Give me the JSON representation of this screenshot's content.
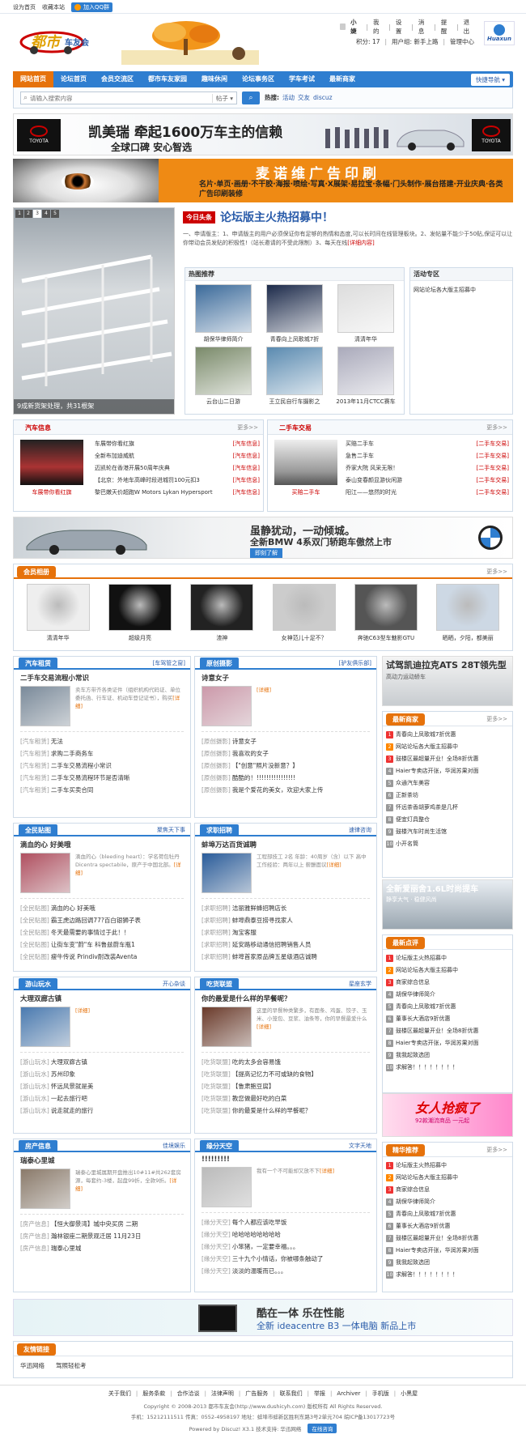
{
  "topbar": {
    "home": "设为首页",
    "fav": "收藏本站",
    "qq": "加入QQ群"
  },
  "user": {
    "name": "小婕",
    "my": "我的",
    "settings": "设置",
    "messages": "消息",
    "reminders": "提醒",
    "logout": "退出",
    "points": "积分: 17",
    "group": "用户组: 新手上路",
    "admin": "管理中心"
  },
  "logo": {
    "right_text": "Huaxun"
  },
  "nav": {
    "items": [
      "网站首页",
      "论坛首页",
      "会员交流区",
      "都市车友家园",
      "趣味休闲",
      "论坛事务区",
      "学车考试",
      "最新商家"
    ],
    "quick": "快捷导航"
  },
  "search": {
    "placeholder": "请输入搜索内容",
    "type": "帖子",
    "hot_label": "热搜:",
    "hot": [
      "活动",
      "交友",
      "discuz"
    ]
  },
  "banner1": {
    "title": "凯美瑞 牵起1600万车主的信赖",
    "sub": "全球口碑 安心智选"
  },
  "banner2": {
    "title": "麦诺维广告印刷",
    "sub": "名片·单页·画册·不干胶·海报·喷绘·写真·X展架·易拉宝·条幅·门头制作·展台搭建·开业庆典·各类广告印刷装修"
  },
  "slide": {
    "pages": [
      "1",
      "2",
      "3",
      "4",
      "5"
    ],
    "caption": "9成新货架处理，共31根架"
  },
  "headline": {
    "tag": "今日头条",
    "title": "论坛版主火热招募中！",
    "body": "一、申请版主：1、申请版主的用户必须保证你有足够的热情和态度,可以长时间在线管理板块。2、发帖量不能少于50贴,保证可以让你带动会员发贴的积极性!（站长邀请的不受此限制）3、每天在线",
    "more": "[详细内容]"
  },
  "hot": {
    "title": "热图推荐",
    "items": [
      "胡保华律师简介",
      "青春向上凤歌城7折",
      "清清年华",
      "云台山二日游",
      "王立民自行车摄影之",
      "2013年11月CTCC赛车"
    ]
  },
  "activity": {
    "title": "活动专区",
    "items": [
      "网站论坛各大版主招募中"
    ]
  },
  "carinfo": {
    "title": "汽车信息",
    "more": "更多>>",
    "caption": "车展带你看红旗",
    "items": [
      {
        "t": "车展带你看红旗",
        "c": "[汽车信息]"
      },
      {
        "t": "全新布加迪威航",
        "c": "[汽车信息]"
      },
      {
        "t": "迈凯轮在香港开展50周年庆典",
        "c": "[汽车信息]"
      },
      {
        "t": "【北京：外地车高峰时段进城罚100元扣3",
        "c": "[汽车信息]"
      },
      {
        "t": "黎巴嫩天价超跑W Motors Lykan Hypersport",
        "c": "[汽车信息]"
      }
    ]
  },
  "usedcar": {
    "title": "二手车交易",
    "more": "更多>>",
    "caption": "买赔二手车",
    "items": [
      {
        "t": "买赔二手车",
        "c": "[二手车交易]"
      },
      {
        "t": "急售二手车",
        "c": "[二手车交易]"
      },
      {
        "t": "乔家大院 风采无限！",
        "c": "[二手车交易]"
      },
      {
        "t": "泰山变春颜显游伙闲游",
        "c": "[二手车交易]"
      },
      {
        "t": "阳江——悠然的时光",
        "c": "[二手车交易]"
      }
    ]
  },
  "bmw": {
    "title": "虽静犹动，一动倾城。",
    "sub": "全新BMW 4系双门轿跑车傲然上市",
    "btn": "即刻了解"
  },
  "album": {
    "title": "会员相册",
    "more": "更多>>",
    "items": [
      "清清年华",
      "超级月亮",
      "渣神",
      "女神范儿十足不？",
      "奔驰C63型车魅影GTU",
      "晒晒，夕阳，都美丽"
    ]
  },
  "panels": {
    "p1": {
      "title": "汽车租赁",
      "tag": "[车驾管之窗]",
      "head": "二手车交易流程小常识",
      "desc": "卖车方带齐各类证件（组织机构代码证、单位委托函、行车证、机动车登记证书），购买",
      "more": "[详细]",
      "items": [
        {
          "c": "[汽车租赁]",
          "t": "无法"
        },
        {
          "c": "[汽车租赁]",
          "t": "求购二手商务车"
        },
        {
          "c": "[汽车租赁]",
          "t": "二手车交易流程小常识"
        },
        {
          "c": "[汽车租赁]",
          "t": "二手车交易流程环节是否清晰"
        },
        {
          "c": "[汽车租赁]",
          "t": "二手车买卖合同"
        }
      ]
    },
    "p2": {
      "title": "原创摄影",
      "tag": "[驴友俱乐部]",
      "head": "诗意女子",
      "desc": "",
      "more": "[详细]",
      "items": [
        {
          "c": "[原创摄影]",
          "t": "诗意女子"
        },
        {
          "c": "[原创摄影]",
          "t": "我喜欢的女子"
        },
        {
          "c": "[原创摄影]",
          "t": "【\"创意\"照片没新意？】"
        },
        {
          "c": "[原创摄影]",
          "t": "酷酷的！!!!!!!!!!!!!!!!!"
        },
        {
          "c": "[原创摄影]",
          "t": "我是个爱花的美女，欢迎大家上传"
        }
      ]
    },
    "p3": {
      "title": "全民贴图",
      "tag": "聚焦天下事",
      "head": "滴血的心 好美哦",
      "desc": "滴血的心（bleeding heart）：学名荷包牡丹 Dicentra spectabile，原产于中国北部。",
      "more": "[详细]",
      "items": [
        {
          "c": "[全民贴图]",
          "t": "滴血的心 好美哦"
        },
        {
          "c": "[全民贴图]",
          "t": "霸王虎边路回调77?百白银狮子表"
        },
        {
          "c": "[全民贴图]",
          "t": "冬天最需要的事情过于此！！"
        },
        {
          "c": "[全民贴图]",
          "t": "让街车变\"蔚\"车 科鲁兹蔚车瓶1"
        },
        {
          "c": "[全民贴图]",
          "t": "瘦牛传说 Prindiv耐改装Aventa"
        }
      ]
    },
    "p4": {
      "title": "求职招聘",
      "tag": "速律咨询",
      "head": "蚌埠万达百货诚聘",
      "desc": "工程部技工 2名 年龄：40周岁（含）以下 高中 工作经验：两年以上 薪酬面议",
      "more": "[详细]",
      "items": [
        {
          "c": "[求职招聘]",
          "t": "洁丽雅鲜蜂招聘店长"
        },
        {
          "c": "[求职招聘]",
          "t": "蚌埠鼎泰豆捞寻找家人"
        },
        {
          "c": "[求职招聘]",
          "t": "淘宝客服"
        },
        {
          "c": "[求职招聘]",
          "t": "延安路移动通信招聘销售人员"
        },
        {
          "c": "[求职招聘]",
          "t": "蚌埠首家原品牌五星级酒店诚聘"
        }
      ]
    },
    "p5": {
      "title": "游山玩水",
      "tag": "开心杂谈",
      "head": "大理双廊古镇",
      "desc": "",
      "more": "[详细]",
      "items": [
        {
          "c": "[游山玩水]",
          "t": "大理双廊古镇"
        },
        {
          "c": "[游山玩水]",
          "t": "苏州印象"
        },
        {
          "c": "[游山玩水]",
          "t": "怀远风景就是美"
        },
        {
          "c": "[游山玩水]",
          "t": "一起去旅行吧"
        },
        {
          "c": "[游山玩水]",
          "t": "说走就走的旅行"
        }
      ]
    },
    "p6": {
      "title": "吃货联盟",
      "tag": "星座玄学",
      "head": "你的最爱是什么样的早餐呢？",
      "desc": "这里的早餐种类繁多，有面条、鸡蛋、饺子、玉米、小笼包、豆浆、油条等，你的早餐最爱什么",
      "more": "[详细]",
      "items": [
        {
          "c": "[吃货联盟]",
          "t": "吃的太多会容易饿"
        },
        {
          "c": "[吃货联盟]",
          "t": "【提高记忆力不可或缺的食物】"
        },
        {
          "c": "[吃货联盟]",
          "t": "【鲁肃鲍豆腐】"
        },
        {
          "c": "[吃货联盟]",
          "t": "教您做最好吃的白菜"
        },
        {
          "c": "[吃货联盟]",
          "t": "你的最爱是什么样的早餐呢？"
        }
      ]
    },
    "p7": {
      "title": "房产信息",
      "tag": "佳境娱乐",
      "head": "瑞泰心里城",
      "desc": "瑞泰心里城属期开盘推出10#11#共262套房源，每套约-3楼，起盘99折，全款9折。",
      "more": "[详细]",
      "items": [
        {
          "c": "[房产信息]",
          "t": "【恒大御景湾】城中央买房 二期"
        },
        {
          "c": "[房产信息]",
          "t": "瀚林银座二期景观迁居 11月23日"
        },
        {
          "c": "[房产信息]",
          "t": "瑞泰心里城"
        }
      ]
    },
    "p8": {
      "title": "缘分天空",
      "tag": "文字天地",
      "head": "!!!!!!!!!",
      "desc": "我有一个不可能却又放不下",
      "more": "[详细]",
      "items": [
        {
          "c": "[缘分天空]",
          "t": "每个人都应该吃早饭"
        },
        {
          "c": "[缘分天空]",
          "t": "哈哈哈哈哈哈哈哈"
        },
        {
          "c": "[缘分天空]",
          "t": "小笨猪，一定要幸福。。。"
        },
        {
          "c": "[缘分天空]",
          "t": "三十九个小情话，你被哪条触动了"
        },
        {
          "c": "[缘分天空]",
          "t": "淡淡的温暖而已。。。"
        }
      ]
    }
  },
  "side": {
    "ad1": {
      "title": "试驾凯迪拉克ATS 28T领先型",
      "sub": "高动力运动轿车"
    },
    "shops": {
      "title": "最新商家",
      "more": "更多>>",
      "items": [
        "青春向上凤歌城7折优惠",
        "网站论坛各大版主招募中",
        "鼓楼区最超量开业！全场8折优惠",
        "Haier专卖店开张，华润苏果对面",
        "众通汽车美容",
        "正新茶坊",
        "怀远茶香胡萝鸡茶是几杯",
        "便宜灯具整仓",
        "鼓楼汽车时尚生活馆",
        "小开名筒"
      ]
    },
    "ad2": {
      "title": "全新爱丽舍1.6L时尚提车",
      "sub": "静享大气 · 稳健风尚"
    },
    "latest": {
      "title": "最新点评",
      "items": [
        "论坛版主火热招募中",
        "网站论坛各大版主招募中",
        "商家综合信息",
        "胡保华律师简介",
        "青春向上凤歌城7折优惠",
        "董事长大酒店9折优惠",
        "鼓楼区最超量开业！全场8折优惠",
        "Haier专卖店开张，华润苏果对面",
        "我我起致选团",
        "求解答！！！！！！！！"
      ]
    },
    "ad3": {
      "title": "女人抢疯了",
      "sub": "92款潮流商品 一元起"
    },
    "best": {
      "title": "精华推荐",
      "more": "更多>>",
      "items": [
        "论坛版主火热招募中",
        "网站论坛各大版主招募中",
        "商家综合信息",
        "胡保华律师简介",
        "青春向上凤歌城7折优惠",
        "董事长大酒店9折优惠",
        "鼓楼区最超量开业！全场8折优惠",
        "Haier专卖店开张，华润苏果对面",
        "我我起致选团",
        "求解答！！！！！！！！"
      ]
    }
  },
  "lenovo": {
    "title": "酷在一体 乐在性能",
    "sub": "全新 ideacentre B3 一体电脑 新品上市"
  },
  "links": {
    "title": "友情链接",
    "items": [
      "华迅网络",
      "驾照轻松考"
    ]
  },
  "footer": {
    "links": [
      "关于我们",
      "服务条款",
      "合作洽谈",
      "法律声明",
      "广告服务",
      "联系我们",
      "举报",
      "Archiver",
      "手机版",
      "小黑屋"
    ],
    "copy": "Copyright © 2008-2013 都市车友会(http://www.dushicyh.com) 版权所有 All Rights Reserved.",
    "contact": "手机：15212111511 传真：0552-4958197 地址：蚌埠市蚌新区胜利东路3号2单元704 皖ICP备13017723号",
    "powered": "Powered by Discuz! X3.1 技术支持: 华迅网络",
    "online": "在线咨询"
  },
  "colors": {
    "brand": "#2f7ed0",
    "accent": "#e6720b",
    "red": "#cc0000"
  }
}
